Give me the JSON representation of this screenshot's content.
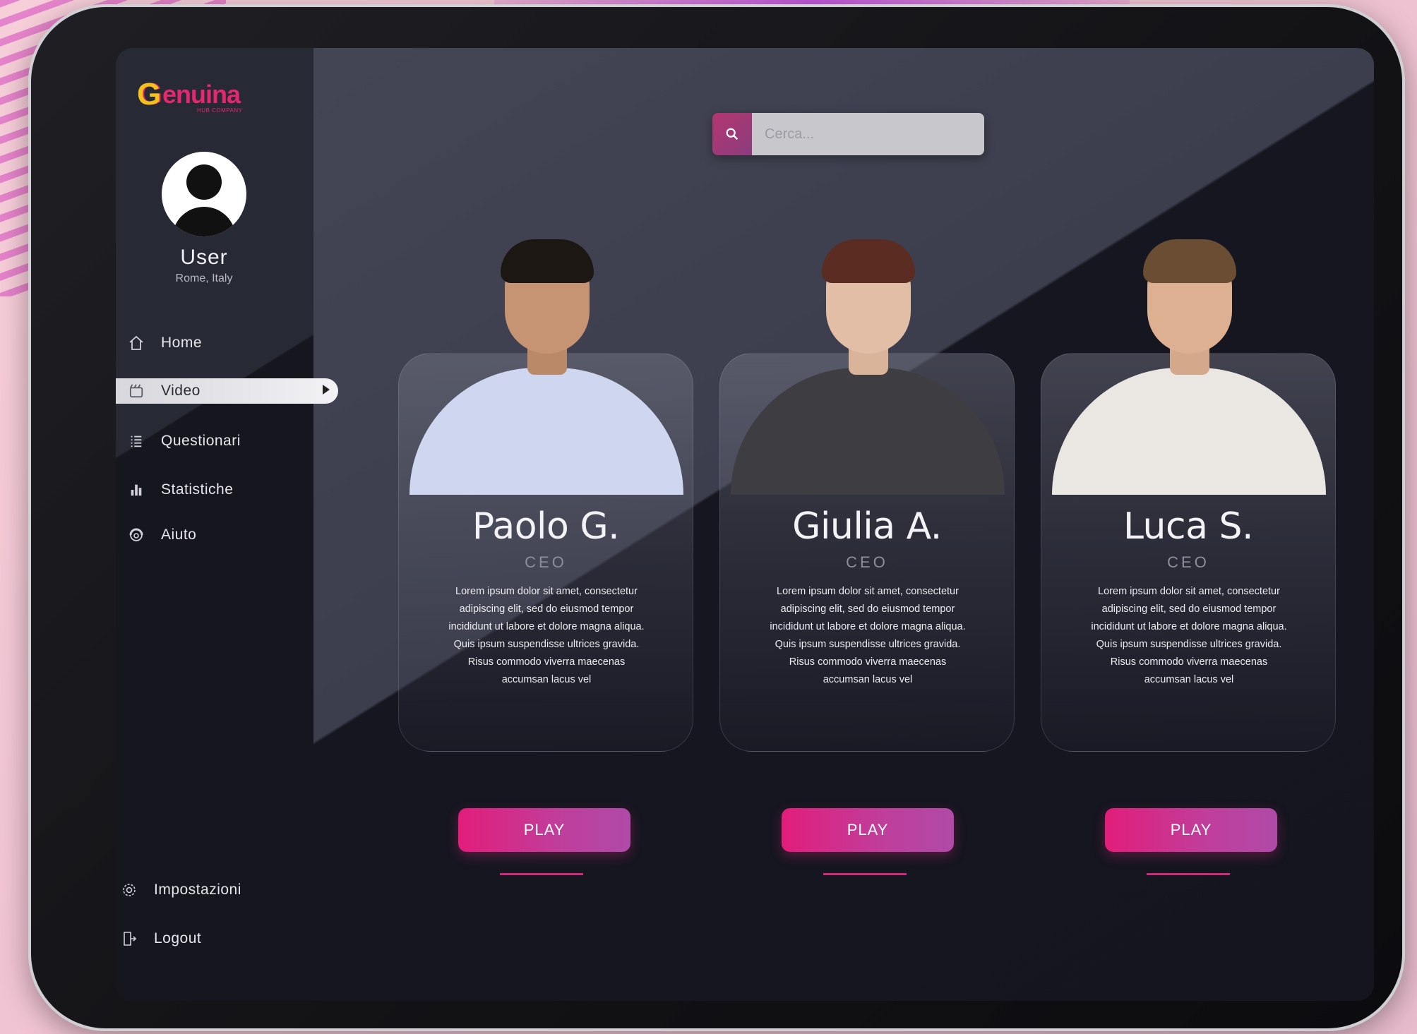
{
  "app": {
    "logo_letter": "G",
    "logo_text": "enuina",
    "logo_sub": "HUB COMPANY"
  },
  "user": {
    "name": "User",
    "location": "Rome, Italy"
  },
  "nav": {
    "items": [
      {
        "label": "Home",
        "icon": "home-icon"
      },
      {
        "label": "Video",
        "icon": "video-icon",
        "active": true
      },
      {
        "label": "Questionari",
        "icon": "list-icon"
      },
      {
        "label": "Statistiche",
        "icon": "chart-icon"
      },
      {
        "label": "Aiuto",
        "icon": "help-icon"
      }
    ],
    "bottom": [
      {
        "label": "Impostazioni",
        "icon": "gear-icon"
      },
      {
        "label": "Logout",
        "icon": "logout-icon"
      }
    ]
  },
  "search": {
    "placeholder": "Cerca..."
  },
  "cards": [
    {
      "name": "Paolo G.",
      "role": "CEO",
      "description": "Lorem ipsum dolor sit amet, consectetur adipiscing elit, sed do eiusmod tempor incididunt ut labore et dolore magna aliqua. Quis ipsum suspendisse ultrices gravida. Risus commodo viverra maecenas accumsan lacus vel",
      "play_label": "PLAY"
    },
    {
      "name": "Giulia A.",
      "role": "CEO",
      "description": "Lorem ipsum dolor sit amet, consectetur adipiscing elit, sed do eiusmod tempor incididunt ut labore et dolore magna aliqua. Quis ipsum suspendisse ultrices gravida. Risus commodo viverra maecenas accumsan lacus vel",
      "play_label": "PLAY"
    },
    {
      "name": "Luca S.",
      "role": "CEO",
      "description": "Lorem ipsum dolor sit amet, consectetur adipiscing elit, sed do eiusmod tempor incididunt ut labore et dolore magna aliqua. Quis ipsum suspendisse ultrices gravida. Risus commodo viverra maecenas accumsan lacus vel",
      "play_label": "PLAY"
    }
  ],
  "colors": {
    "accent": "#e21d7a",
    "sidebar": "#16161e",
    "logo_yellow": "#f2c21b"
  }
}
